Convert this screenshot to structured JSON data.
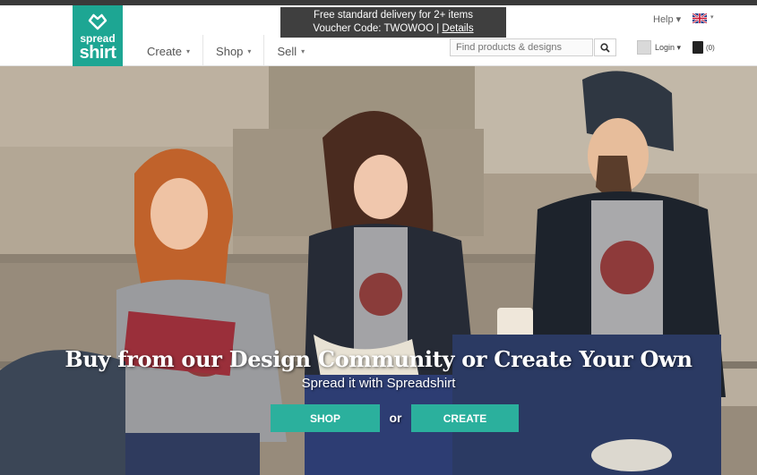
{
  "logo": {
    "line1": "spread",
    "line2": "shirt",
    "color": "#1da693"
  },
  "nav": {
    "items": [
      {
        "label": "Create",
        "caret": "▾"
      },
      {
        "label": "Shop",
        "caret": "▾"
      },
      {
        "label": "Sell",
        "caret": "▾"
      }
    ]
  },
  "promo": {
    "line1": "Free standard delivery for 2+ items",
    "line2_prefix": "Voucher Code: TWOWOO | ",
    "details_link": "Details"
  },
  "utility": {
    "help_label": "Help ▾",
    "language_caret": "▾",
    "login_label": "Login ▾",
    "cart_count": "(0)"
  },
  "search": {
    "placeholder": "Find products & designs",
    "value": ""
  },
  "hero": {
    "headline": "Buy from our Design Community or Create Your Own",
    "subline": "Spread it with Spreadshirt",
    "shop_button": "SHOP",
    "or_text": "or",
    "create_button": "CREATE",
    "accent_color": "#2bb09d"
  },
  "icons": [
    "heart-logo-icon",
    "search-icon",
    "flag-uk-icon",
    "user-avatar-icon",
    "shopping-bag-icon"
  ]
}
